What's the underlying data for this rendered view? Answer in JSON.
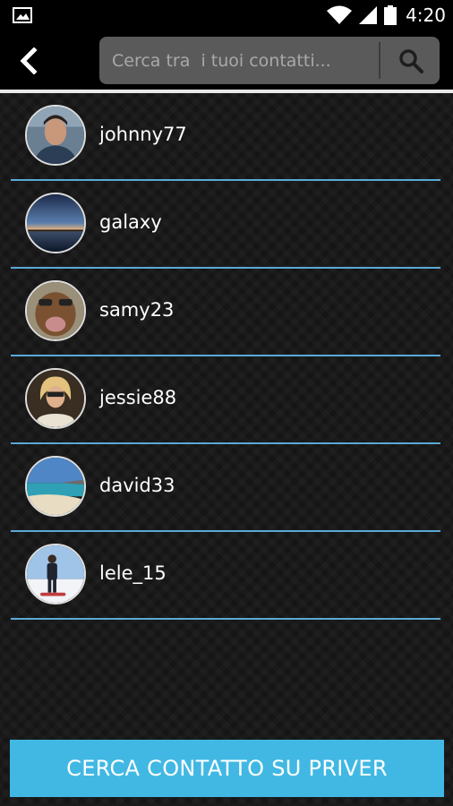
{
  "status_bar": {
    "time": "4:20",
    "left_icon": "image-icon",
    "right_icons": [
      "wifi-icon",
      "signal-icon",
      "battery-icon"
    ]
  },
  "header": {
    "back_icon": "chevron-left-icon",
    "search": {
      "placeholder": "Cerca tra  i tuoi contatti..."
    },
    "search_icon": "search-icon"
  },
  "contacts": [
    {
      "name": "johnny77",
      "avatar": "portrait"
    },
    {
      "name": "galaxy",
      "avatar": "sunset-lake"
    },
    {
      "name": "samy23",
      "avatar": "dog"
    },
    {
      "name": "jessie88",
      "avatar": "blonde-woman"
    },
    {
      "name": "david33",
      "avatar": "beach"
    },
    {
      "name": "lele_15",
      "avatar": "snowboarder"
    }
  ],
  "footer": {
    "button_label": "CERCA CONTATTO SU PRIVER"
  },
  "colors": {
    "accent": "#41b8e4",
    "divider": "#5aa9d6",
    "background": "#151515",
    "search_bg": "#5a5a5a"
  }
}
